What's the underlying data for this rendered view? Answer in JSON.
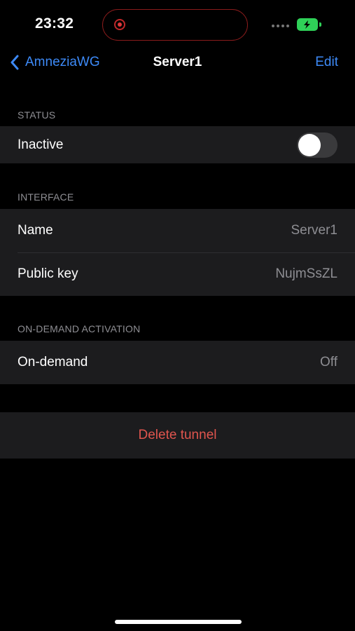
{
  "status_bar": {
    "time": "23:32"
  },
  "nav": {
    "back_label": "AmneziaWG",
    "title": "Server1",
    "edit_label": "Edit"
  },
  "status_section": {
    "header": "STATUS",
    "row_label": "Inactive",
    "toggle_on": false
  },
  "interface_section": {
    "header": "INTERFACE",
    "rows": [
      {
        "label": "Name",
        "value": "Server1"
      },
      {
        "label": "Public key",
        "value": "NujmSsZL"
      }
    ]
  },
  "on_demand_section": {
    "header": "ON-DEMAND ACTIVATION",
    "row_label": "On-demand",
    "row_value": "Off"
  },
  "delete": {
    "label": "Delete tunnel"
  },
  "colors": {
    "accent": "#3d8af7",
    "destructive": "#e0554e",
    "cell_bg": "#1c1c1e",
    "battery": "#2fd158"
  }
}
